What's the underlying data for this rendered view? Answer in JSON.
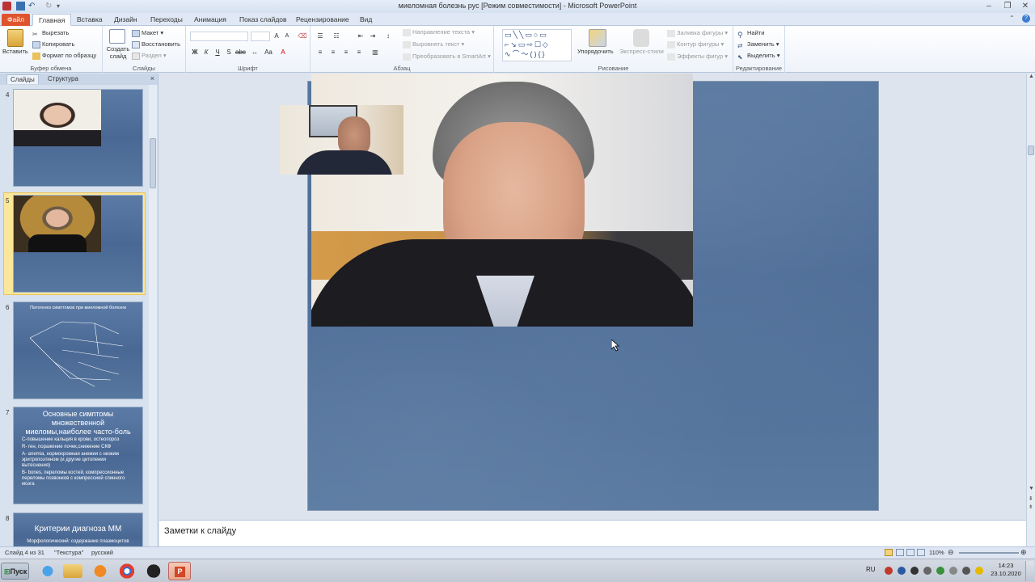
{
  "window": {
    "title": "миеломная болезнь рус [Режим совместимости] - Microsoft PowerPoint",
    "controls": [
      "–",
      "❐",
      "✕"
    ]
  },
  "ribbon_tabs": [
    "Файл",
    "Главная",
    "Вставка",
    "Дизайн",
    "Переходы",
    "Анимация",
    "Показ слайдов",
    "Рецензирование",
    "Вид"
  ],
  "ribbon": {
    "clipboard": {
      "paste": "Вставить",
      "cut": "Вырезать",
      "copy": "Копировать",
      "format_painter": "Формат по образцу",
      "label": "Буфер обмена"
    },
    "slides": {
      "new_slide": "Создать слайд",
      "layout": "Макет",
      "reset": "Восстановить",
      "section": "Раздел",
      "label": "Слайды"
    },
    "font": {
      "label": "Шрифт"
    },
    "paragraph": {
      "text_direction": "Направление текста",
      "align_text": "Выровнять текст",
      "smartart": "Преобразовать в SmartArt",
      "label": "Абзац"
    },
    "drawing": {
      "arrange": "Упорядочить",
      "quick_styles": "Экспресс-стили",
      "shape_fill": "Заливка фигуры",
      "shape_outline": "Контур фигуры",
      "shape_effects": "Эффекты фигур",
      "label": "Рисование"
    },
    "editing": {
      "find": "Найти",
      "replace": "Заменить",
      "select": "Выделить",
      "label": "Редактирование"
    }
  },
  "pane": {
    "tabs": [
      "Слайды",
      "Структура"
    ],
    "close": "×",
    "slides": [
      {
        "num": "4"
      },
      {
        "num": "5"
      },
      {
        "num": "6",
        "title": "Патогенез симптомов при миеломной болезни"
      },
      {
        "num": "7",
        "title": "Основные симптомы множественной миеломы,наиболее часто-боль",
        "lines": [
          "С-повышение кальция в крови, остеопороз",
          "R- rен, поражение почек,снижение СКФ",
          "А- anemia, нормохромная анемия с низким эритропоэтином (и другие цитопении вытеснения)",
          "B- bones, переломы костей, компрессионные переломы позвонков с компрессией спинного мозга"
        ]
      },
      {
        "num": "8",
        "title": "Критерии диагноза ММ",
        "lines": [
          "Морфологический: содержание плазмоцитов"
        ]
      }
    ]
  },
  "notes_placeholder": "Заметки к слайду",
  "status": {
    "slide": "Слайд 4 из 31",
    "theme": "\"Текстура\"",
    "language": "русский",
    "zoom": "110%"
  },
  "taskbar": {
    "start": "Пуск",
    "lang": "RU",
    "time": "14:23",
    "date": "23.10.2020"
  }
}
